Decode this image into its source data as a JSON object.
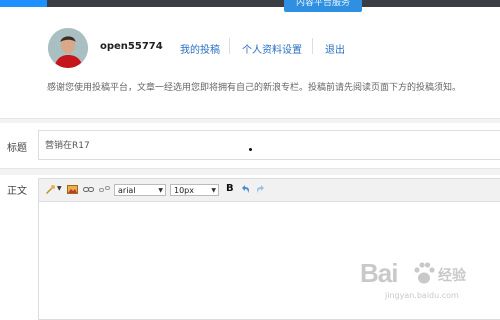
{
  "topbar": {
    "active_tab": "内容平台服务"
  },
  "user": {
    "name": "open55774"
  },
  "nav": [
    {
      "label": "我的投稿"
    },
    {
      "label": "个人资料设置"
    },
    {
      "label": "退出"
    }
  ],
  "notice": "感谢您使用投稿平台，文章一经选用您即将拥有自己的新浪专栏。投稿前请先阅读页面下方的投稿须知。",
  "form": {
    "title_label": "标题",
    "title_value": "营销在R17",
    "body_label": "正文"
  },
  "toolbar": {
    "font_family": "arial",
    "font_size": "10px",
    "bold": "B",
    "icons": [
      "template-icon",
      "image-icon",
      "link-icon",
      "unlink-icon",
      "undo-icon",
      "redo-icon"
    ]
  },
  "watermark": {
    "brand": "Bai",
    "cn": "经验",
    "url": "jingyan.baidu.com"
  }
}
